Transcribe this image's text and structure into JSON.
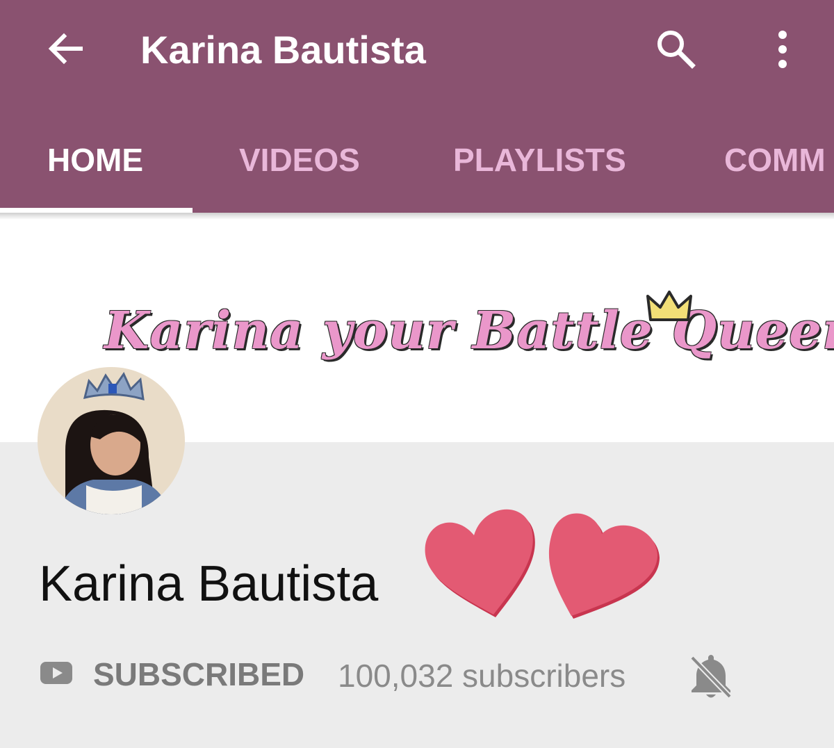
{
  "appbar": {
    "title": "Karina Bautista",
    "back_icon": "arrow-back-icon",
    "search_icon": "search-icon",
    "more_icon": "more-vert-icon",
    "color": "#8a5270"
  },
  "tabs": [
    {
      "label": "HOME",
      "active": true
    },
    {
      "label": "VIDEOS",
      "active": false
    },
    {
      "label": "PLAYLISTS",
      "active": false
    },
    {
      "label": "COMM",
      "active": false
    }
  ],
  "banner": {
    "text": "Karina your Battle Queen",
    "accent": "#ea97ca"
  },
  "channel": {
    "name": "Karina Bautista",
    "subscribed_label": "SUBSCRIBED",
    "subscribers": "100,032 subscribers",
    "notification_icon": "bell-off-icon",
    "heart_color": "#e35a73"
  }
}
